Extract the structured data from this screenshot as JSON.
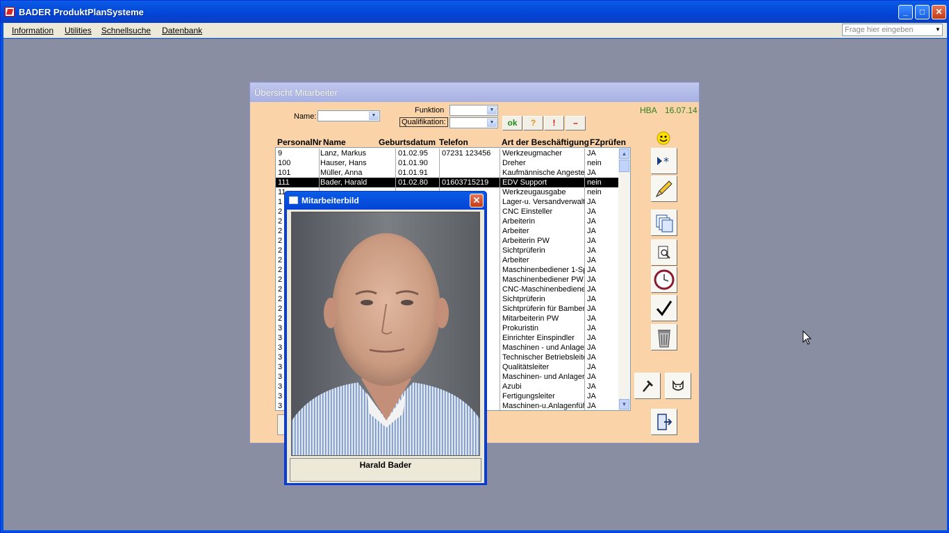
{
  "app": {
    "title": "BADER ProduktPlanSysteme"
  },
  "menu": [
    {
      "label": "Information"
    },
    {
      "label": "Utilities"
    },
    {
      "label": "Schnellsuche"
    },
    {
      "label": "Datenbank"
    }
  ],
  "ask": {
    "placeholder": "Frage hier eingeben"
  },
  "form": {
    "title": "Übersicht Mitarbeiter",
    "name_label": "Name:",
    "funktion_label": "Funktion",
    "qualifikation_label": "Qualifikation:",
    "user": "HBA",
    "date": "16.07.14",
    "buttons": {
      "ok": "ok",
      "question": "?",
      "excl": "!",
      "minus": "–"
    },
    "columns": [
      "PersonalNr",
      "Name",
      "Geburtsdatum",
      "Telefon",
      "Art der Beschäftigung",
      "FZprüfen"
    ],
    "rows": [
      [
        "9",
        "Lanz, Markus",
        "01.02.95",
        "07231 123456",
        "Werkzeugmacher",
        "JA"
      ],
      [
        "100",
        "Hauser, Hans",
        "01.01.90",
        "",
        "Dreher",
        "nein"
      ],
      [
        "101",
        "Müller, Anna",
        "01.01.91",
        "",
        "Kaufmännische Angeste",
        "JA"
      ],
      [
        "111",
        "Bader, Harald",
        "01.02.80",
        "01603715219",
        "EDV Support",
        "nein"
      ],
      [
        "11",
        "",
        "",
        "",
        "Werkzeugausgabe",
        "nein"
      ],
      [
        "1",
        "",
        "",
        "",
        "Lager-u. Versandverwalt",
        "JA"
      ],
      [
        "2",
        "",
        "",
        "",
        "CNC Einsteller",
        "JA"
      ],
      [
        "2",
        "",
        "",
        "",
        "Arbeiterin",
        "JA"
      ],
      [
        "2",
        "",
        "",
        "22",
        "Arbeiter",
        "JA"
      ],
      [
        "2",
        "",
        "",
        "3",
        "Arbeiterin PW",
        "JA"
      ],
      [
        "2",
        "",
        "",
        "",
        "Sichtprüferin",
        "JA"
      ],
      [
        "2",
        "",
        "",
        "7",
        "Arbeiter",
        "JA"
      ],
      [
        "2",
        "",
        "",
        "3",
        "Maschinenbediener 1-Sp",
        "JA"
      ],
      [
        "2",
        "",
        "",
        "9",
        "Maschinenbediener PW",
        "JA"
      ],
      [
        "2",
        "",
        "",
        "",
        "CNC-Maschinenbediene",
        "JA"
      ],
      [
        "2",
        "",
        "",
        "",
        "Sichtprüferin",
        "JA"
      ],
      [
        "2",
        "",
        "",
        "1",
        "Sichtprüferin für Bamberg",
        "JA"
      ],
      [
        "2",
        "",
        "",
        "",
        "Mitarbeiterin PW",
        "JA"
      ],
      [
        "3",
        "",
        "",
        "4",
        "Prokuristin",
        "JA"
      ],
      [
        "3",
        "",
        "",
        "9",
        "Einrichter Einspindler",
        "JA"
      ],
      [
        "3",
        "",
        "",
        "45",
        "Maschinen - und Anlage",
        "JA"
      ],
      [
        "3",
        "",
        "",
        "00",
        "Technischer Betriebsleite",
        "JA"
      ],
      [
        "3",
        "",
        "",
        "60",
        "Qualitätsleiter",
        "JA"
      ],
      [
        "3",
        "",
        "",
        "73",
        "Maschinen- und Anlager",
        "JA"
      ],
      [
        "3",
        "",
        "",
        "",
        "Azubi",
        "JA"
      ],
      [
        "3",
        "",
        "",
        "",
        "Fertigungsleiter",
        "JA"
      ],
      [
        "3",
        "",
        "",
        "",
        "Maschinen-u.Anlagenfüh",
        "JA"
      ]
    ],
    "selected_row": 3
  },
  "picture_dialog": {
    "title": "Mitarbeiterbild",
    "caption": "Harald Bader"
  },
  "colors": {
    "titlebar": "#0344d6",
    "form_bg": "#fad3a8",
    "workspace": "#8a8ea3",
    "green_text": "#2d7d1c"
  }
}
